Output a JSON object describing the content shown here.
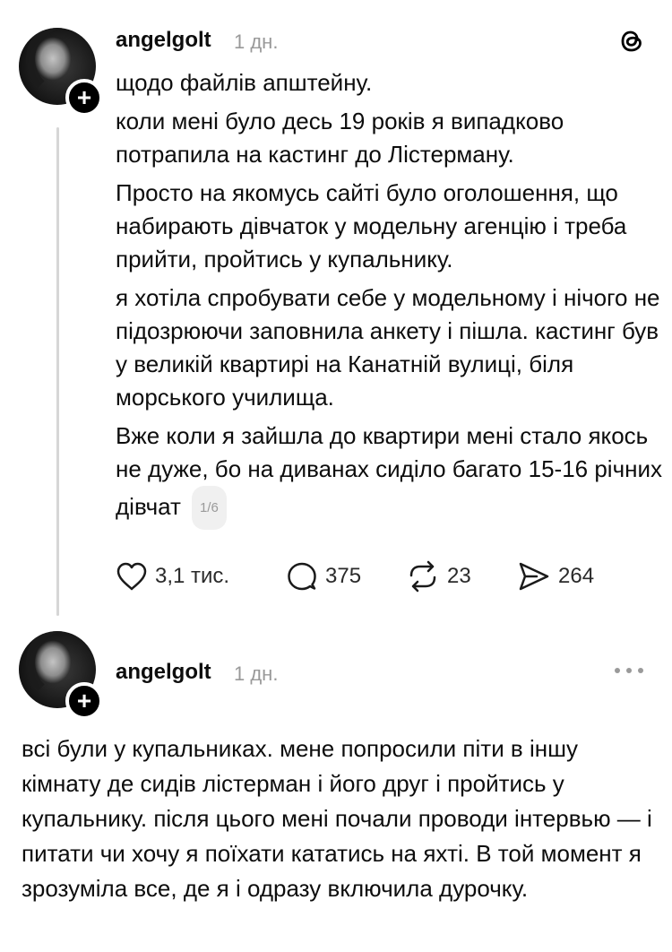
{
  "post1": {
    "username": "angelgolt",
    "time": "1 дн.",
    "paragraphs": [
      "щодо файлів апштейну.",
      "коли мені було десь 19 років я випадково потрапила на кастинг до Лістерману.",
      "Просто на якомусь сайті було оголошення, що набирають дівчаток у модельну агенцію і треба прийти, пройтись у купальнику.",
      "я хотіла спробувати себе у модельному і нічого не підозрюючи заповнила анкету і пішла. кастинг був у великій квартирі на Канатній вулиці, біля морського училища.",
      "Вже коли я зайшла до квартири мені стало якось не дуже, бо на диванах сиділо багато 15-16 річних дівчат"
    ],
    "page_indicator": "1/6",
    "likes": "3,1 тис.",
    "replies": "375",
    "reposts": "23",
    "shares": "264"
  },
  "post2": {
    "username": "angelgolt",
    "time": "1 дн.",
    "text": "всі були у купальниках. мене попросили піти в іншу кімнату де сидів лістерман і його друг і пройтись у купальнику. після цього мені почали проводи інтервью — і питати чи хочу я поїхати кататись на яхті. В той момент я зрозуміла все, де я і одразу включила дурочку."
  },
  "icons": {
    "threads_logo": "threads-logo-icon",
    "more": "more-icon",
    "plus": "plus-icon"
  }
}
